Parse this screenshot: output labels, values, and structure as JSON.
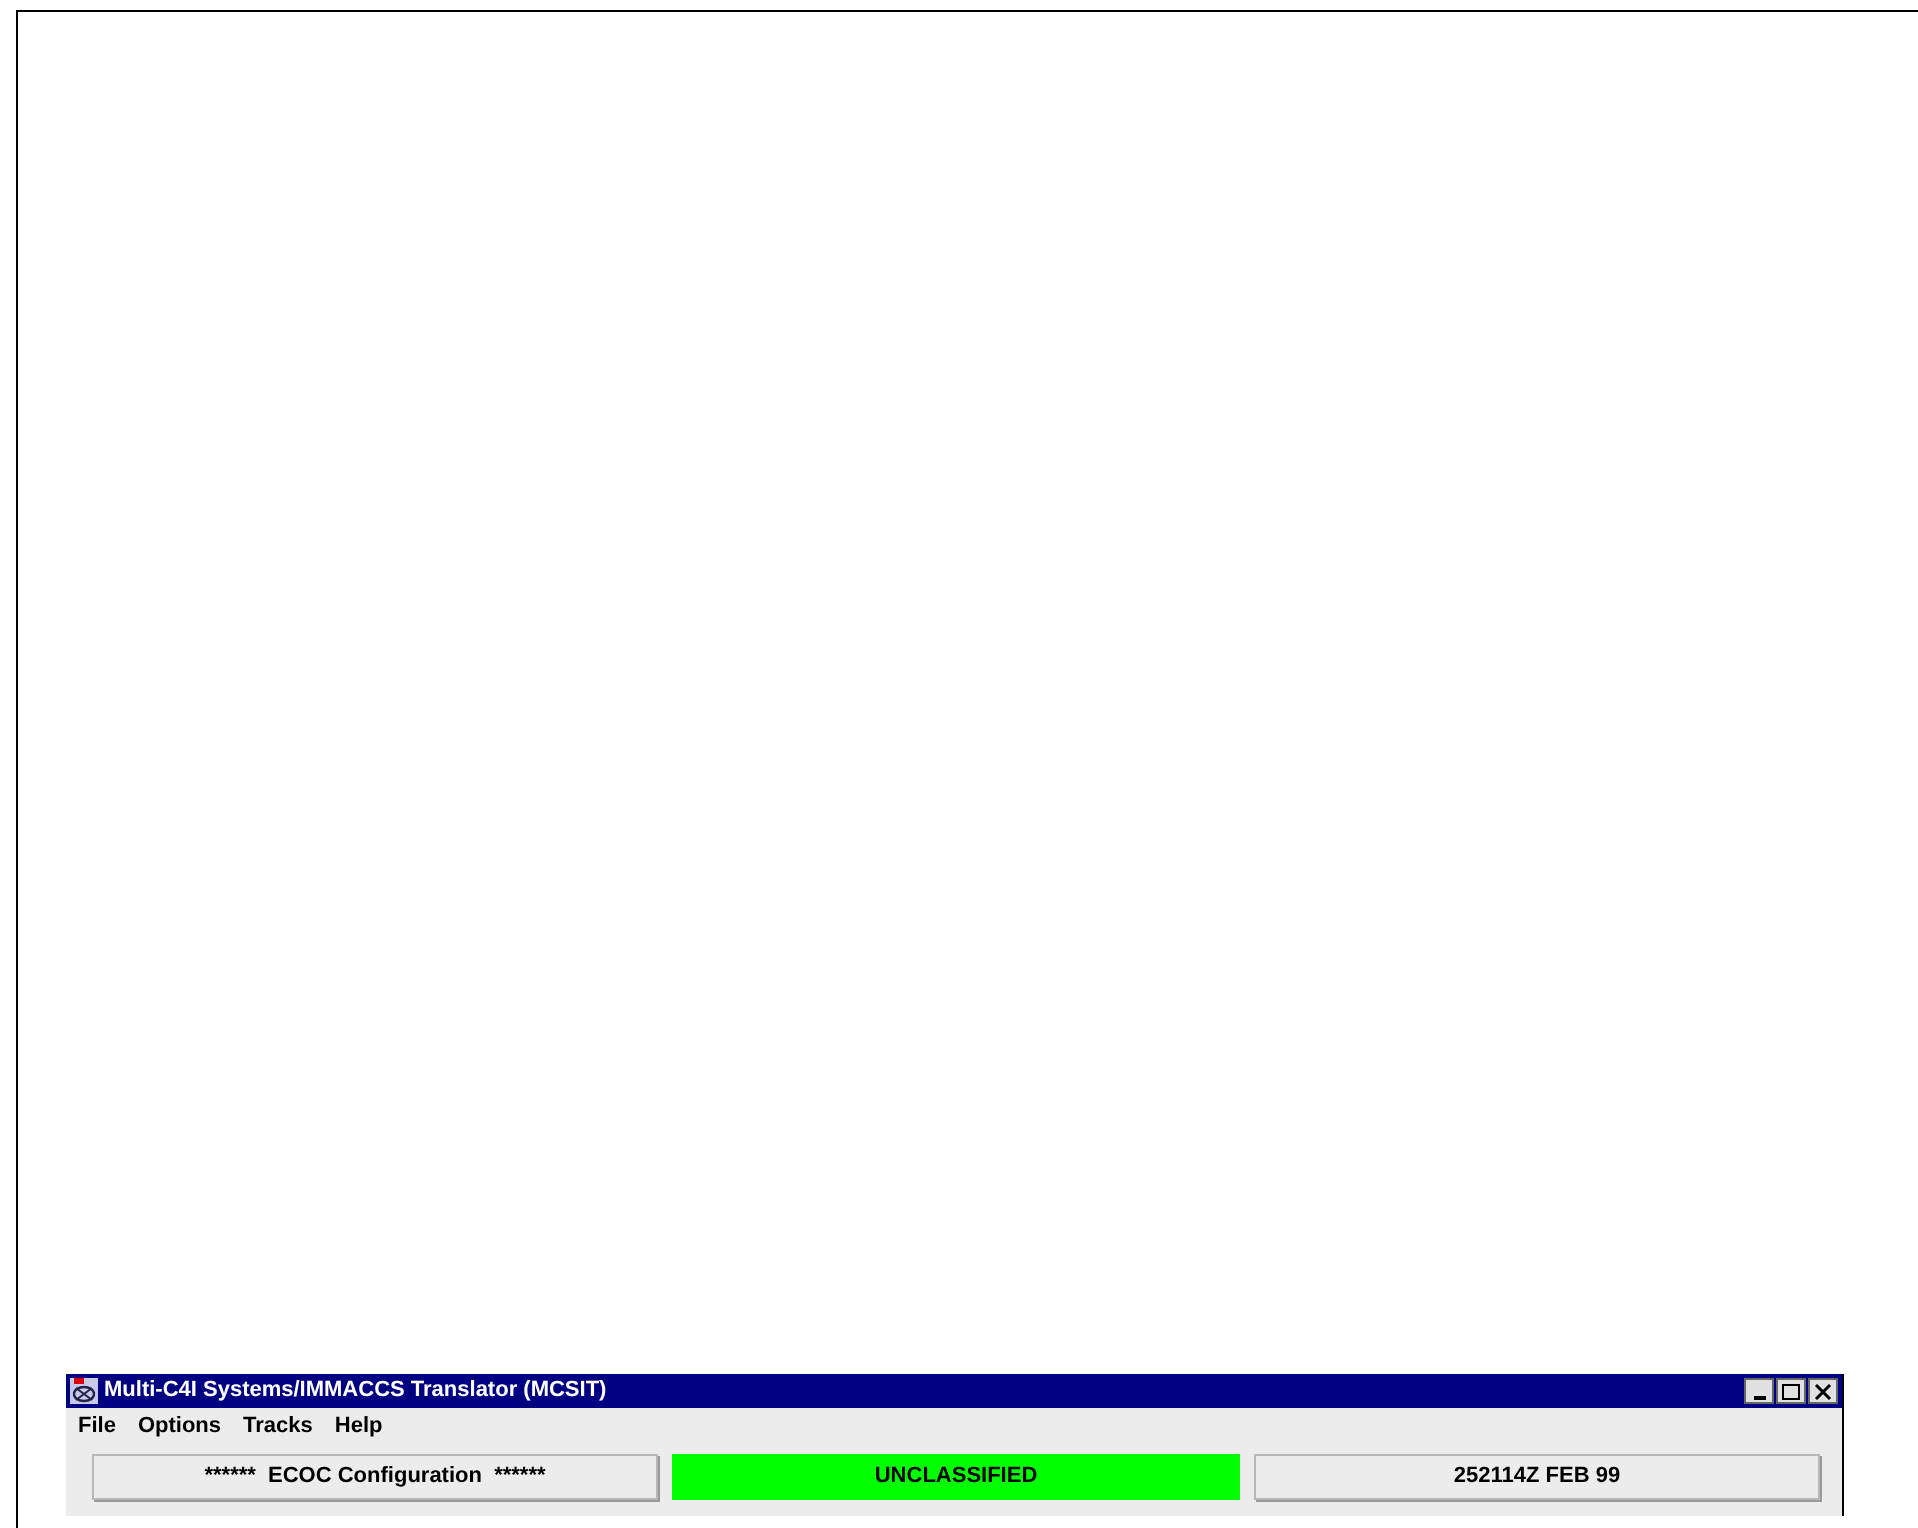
{
  "window": {
    "title": "Multi-C4I Systems/IMMACCS Translator (MCSIT)"
  },
  "menu": [
    "File",
    "Options",
    "Tracks",
    "Help"
  ],
  "status_fields": [
    {
      "kind": "button",
      "label": "******  ECOC Configuration  ******"
    },
    {
      "kind": "indicator",
      "label": "UNCLASSIFIED",
      "color": "#00ff00"
    },
    {
      "kind": "button",
      "label": "252114Z FEB 99"
    }
  ]
}
